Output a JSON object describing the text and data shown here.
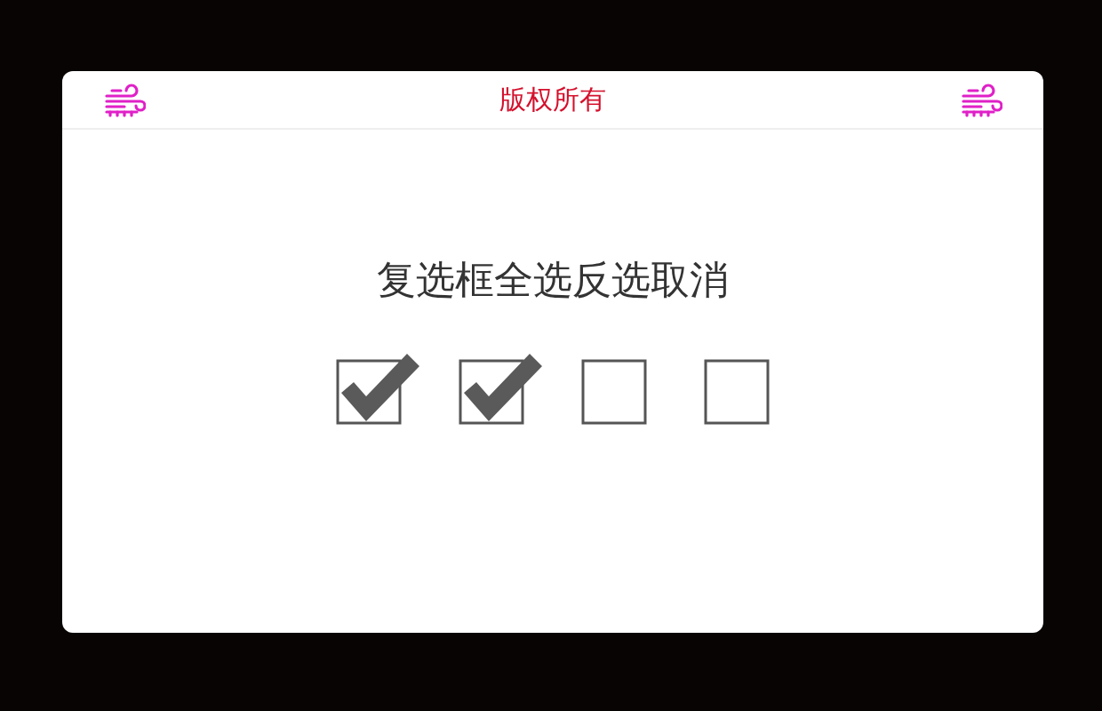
{
  "header": {
    "title": "版权所有"
  },
  "heading": "复选框全选反选取消",
  "checkboxes": [
    {
      "checked": true
    },
    {
      "checked": true
    },
    {
      "checked": false
    },
    {
      "checked": false
    }
  ]
}
